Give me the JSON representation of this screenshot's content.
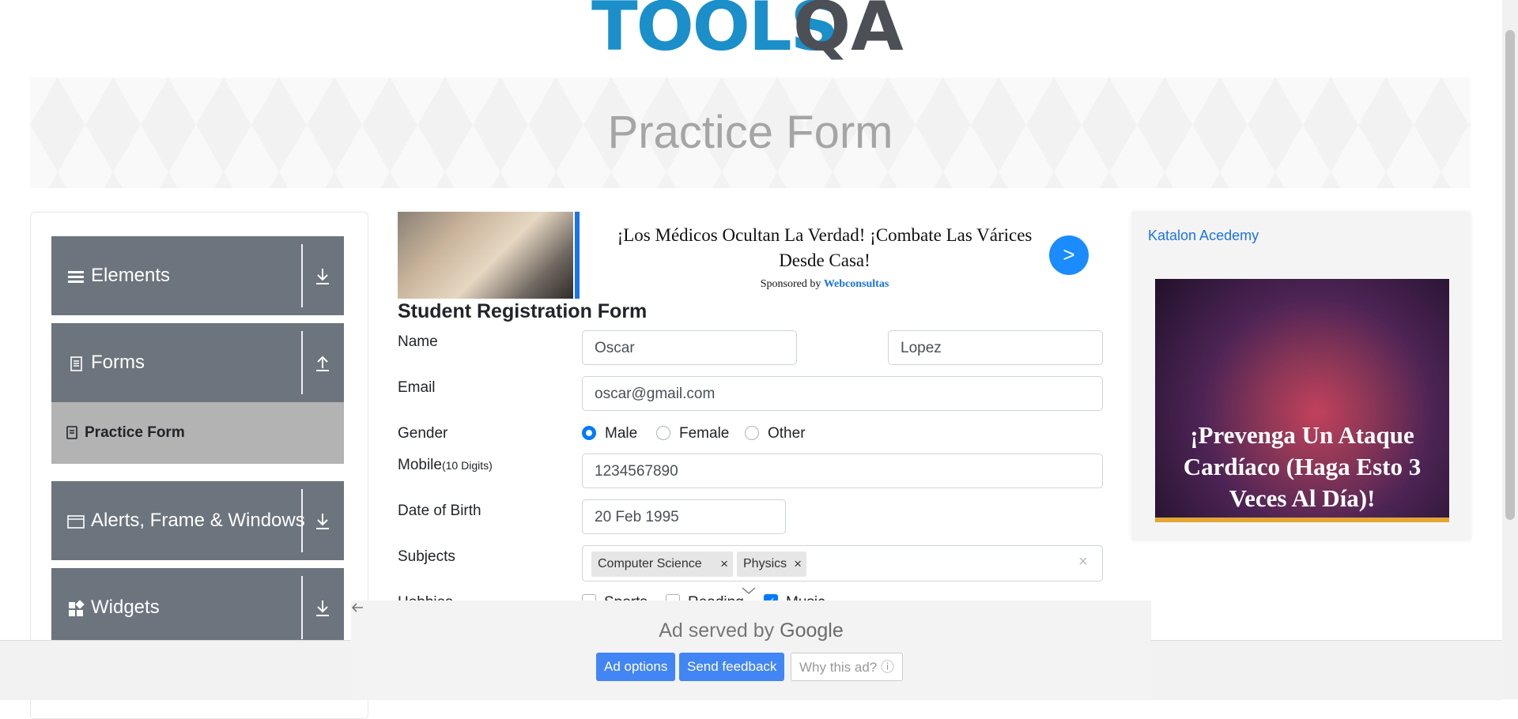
{
  "header": {
    "logo_text": "TOOLS",
    "logo_qa": "QA"
  },
  "banner": {
    "title": "Practice Form"
  },
  "sidebar": {
    "groups": [
      {
        "label": "Elements"
      },
      {
        "label": "Forms",
        "expanded": true,
        "items": [
          {
            "label": "Practice Form"
          }
        ]
      },
      {
        "label": "Alerts, Frame & Windows"
      },
      {
        "label": "Widgets"
      }
    ]
  },
  "top_ad": {
    "headline": "¡Los Médicos Ocultan La Verdad! ¡Combate Las Várices Desde Casa!",
    "sponsored_by": "Sponsored by",
    "sponsor": "Webconsultas",
    "go": ">"
  },
  "form": {
    "title": "Student Registration Form",
    "name_label": "Name",
    "first_name": "Oscar",
    "last_name": "Lopez",
    "email_label": "Email",
    "email": "oscar@gmail.com",
    "gender_label": "Gender",
    "gender_options": [
      "Male",
      "Female",
      "Other"
    ],
    "gender_selected": "Male",
    "mobile_label": "Mobile",
    "mobile_hint": "(10 Digits)",
    "mobile": "1234567890",
    "dob_label": "Date of Birth",
    "dob": "20 Feb 1995",
    "subjects_label": "Subjects",
    "subjects": [
      "Computer Science",
      "Physics"
    ],
    "hobbies_label": "Hobbies",
    "hobbies": [
      "Sports",
      "Reading",
      "Music"
    ],
    "hobbies_checked": [
      "Music"
    ]
  },
  "side_ad": {
    "alt_link": "Katalon Acedemy",
    "image_text": "¡Prevenga Un Ataque Cardíaco (Haga Esto 3 Veces Al Día)!"
  },
  "bottom_ad": {
    "served_by": "Ad served by",
    "brand": "Google",
    "buttons": [
      "Ad options",
      "Send feedback",
      "Why this ad? ⓘ"
    ]
  },
  "colors": {
    "brand_blue": "#1a8fc9",
    "sidebar_bg": "#6c757d",
    "accent": "#007bff"
  }
}
